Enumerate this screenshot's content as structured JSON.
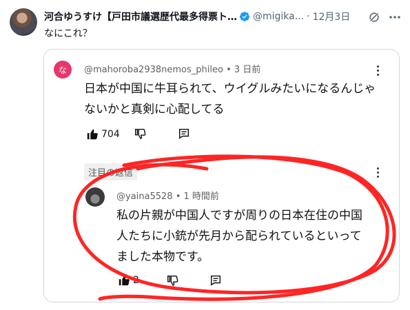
{
  "tweet": {
    "author_name": "河合ゆうすけ【戸田市議選歴代最多得票ト…",
    "handle": "@migika...",
    "dot": "·",
    "date": "12月3日",
    "text": "なにこれ？"
  },
  "card": {
    "comment": {
      "avatar_letter": "な",
      "meta": "@mahoroba2938nemos_phileo • 3 日前",
      "text": "日本が中国に牛耳られて、ウイグルみたいになるんじゃないかと真剣に心配してる",
      "like_count": "704"
    },
    "pinned_label": "注目の返信",
    "reply": {
      "meta": "@yaina5528 • 1 時間前",
      "text": "私の片親が中国人ですが周りの日本在住の中国人たちに小銃が先月から配られているといってました本物です。",
      "like_count": "2"
    }
  },
  "colors": {
    "verified": "#1d9bf0",
    "avatar_pink": "#e5386b",
    "scribble_red": "#ff1a1a"
  }
}
